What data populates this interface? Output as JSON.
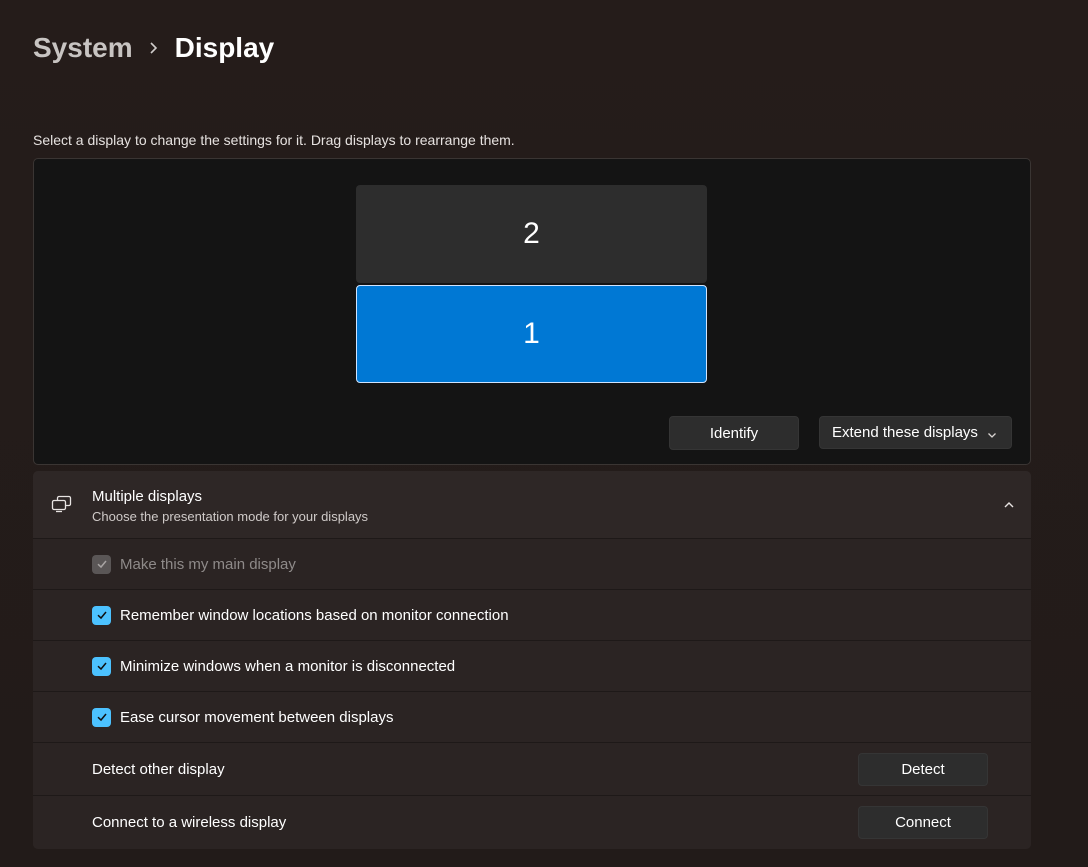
{
  "breadcrumb": {
    "parent": "System",
    "current": "Display"
  },
  "instruction": "Select a display to change the settings for it. Drag displays to rearrange them.",
  "arrangement": {
    "monitors": [
      {
        "label": "2",
        "selected": false
      },
      {
        "label": "1",
        "selected": true
      }
    ],
    "identify_label": "Identify",
    "mode_value": "Extend these displays"
  },
  "multiple_displays": {
    "title": "Multiple displays",
    "subtitle": "Choose the presentation mode for your displays",
    "expanded": true,
    "options": [
      {
        "label": "Make this my main display",
        "checked": true,
        "enabled": false
      },
      {
        "label": "Remember window locations based on monitor connection",
        "checked": true,
        "enabled": true
      },
      {
        "label": "Minimize windows when a monitor is disconnected",
        "checked": true,
        "enabled": true
      },
      {
        "label": "Ease cursor movement between displays",
        "checked": true,
        "enabled": true
      }
    ],
    "detect": {
      "label": "Detect other display",
      "button": "Detect"
    },
    "wireless": {
      "label": "Connect to a wireless display",
      "button": "Connect"
    }
  },
  "icons": {
    "breadcrumb_separator": "chevron-right-icon",
    "mode_dropdown": "chevron-down-icon",
    "header": "multiple-displays-icon",
    "collapse": "chevron-up-icon",
    "checkbox": "checkmark-icon"
  },
  "colors": {
    "accent": "#0078d4",
    "checkbox": "#4cc2ff"
  }
}
